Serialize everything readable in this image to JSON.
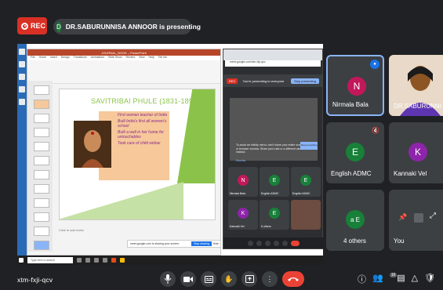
{
  "topbar": {
    "rec_label": "REC",
    "presenter_initial": "D",
    "presenting_text": "DR.SABURUNNISA ANNOOR is presenting"
  },
  "shared_screen": {
    "ppt_title": "JOURNAL_BOOK – PowerPoint",
    "ppt_tabs": [
      "File",
      "Home",
      "Insert",
      "Design",
      "Transitions",
      "Animations",
      "Slide Show",
      "Review",
      "View",
      "Help",
      "Tell me"
    ],
    "slide_title": "SAVITRIBAI PHULE (1831-1897)",
    "bullets": [
      "First woman teacher of India",
      "Built India's first all women's school",
      "Built a well in her home for untouchables",
      "Took care of child widow"
    ],
    "notes_text": "Click to add notes",
    "chrome_address": "meet.google.com/xtm-fxji-qcv",
    "chrome_rec": "REC",
    "chrome_presenting": "You're presenting to everyone",
    "chrome_stop": "Stop presenting",
    "chrome_warning": "To avoid an infinity mirror, don't share your entire screen or browser window. Share just a tab or a different window instead.",
    "chrome_show": "Stop presenting",
    "chrome_dismiss": "Dismiss",
    "mini_tiles": [
      {
        "initial": "N",
        "name": "Nirmala Bala",
        "color": "#c2185b"
      },
      {
        "initial": "E",
        "name": "English ADMC",
        "color": "#188038"
      },
      {
        "initial": "E",
        "name": "English ADMC",
        "color": "#188038"
      },
      {
        "initial": "K",
        "name": "Kannaki Vel",
        "color": "#8e24aa"
      },
      {
        "initial": "E",
        "name": "6 others",
        "color": "#188038"
      },
      {
        "initial": "",
        "name": "",
        "color": "#5f6368"
      }
    ],
    "toast_text": "meet.google.com is sharing your screen.",
    "toast_stop": "Stop sharing",
    "toast_hide": "Hide",
    "taskbar_search": "Type here to search"
  },
  "tiles": [
    {
      "initial": "N",
      "name": "Nirmala Bala",
      "color": "#c2185b"
    },
    {
      "initial": "",
      "name": "DR.SABURUNNI...",
      "color": "#6d4c41"
    },
    {
      "initial": "E",
      "name": "English ADMC",
      "color": "#188038"
    },
    {
      "initial": "K",
      "name": "Kannaki Vel",
      "color": "#8e24aa"
    },
    {
      "initial": "a E",
      "name": "4 others",
      "color": "#188038"
    },
    {
      "initial": "",
      "name": "You",
      "color": "#3c4043"
    }
  ],
  "bottombar": {
    "meeting_code": "xtm-fxji-qcv",
    "participants_badge": "10"
  }
}
